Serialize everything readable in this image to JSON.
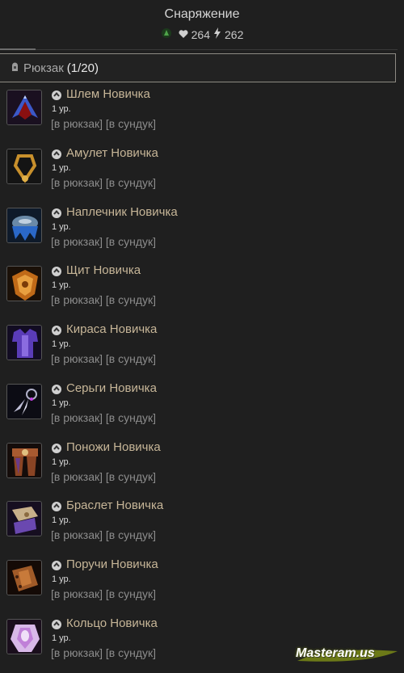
{
  "header": {
    "title": "Снаряжение",
    "health_value": "264",
    "energy_value": "262",
    "accent_color": "#c7b698"
  },
  "backpack": {
    "label": "Рюкзак",
    "count": "(1/20)"
  },
  "items": [
    {
      "name": "Шлем Новичка",
      "level": "1 ур.",
      "to_backpack": "[в рюкзак]",
      "to_chest": "[в сундук]",
      "icon": "helmet-icon"
    },
    {
      "name": "Амулет Новичка",
      "level": "1 ур.",
      "to_backpack": "[в рюкзак]",
      "to_chest": "[в сундук]",
      "icon": "amulet-icon"
    },
    {
      "name": "Наплечник Новичка",
      "level": "1 ур.",
      "to_backpack": "[в рюкзак]",
      "to_chest": "[в сундук]",
      "icon": "shoulder-icon"
    },
    {
      "name": "Щит Новичка",
      "level": "1 ур.",
      "to_backpack": "[в рюкзак]",
      "to_chest": "[в сундук]",
      "icon": "shield-icon"
    },
    {
      "name": "Кираса Новичка",
      "level": "1 ур.",
      "to_backpack": "[в рюкзак]",
      "to_chest": "[в сундук]",
      "icon": "cuirass-icon"
    },
    {
      "name": "Серьги Новичка",
      "level": "1 ур.",
      "to_backpack": "[в рюкзак]",
      "to_chest": "[в сундук]",
      "icon": "earrings-icon"
    },
    {
      "name": "Поножи Новичка",
      "level": "1 ур.",
      "to_backpack": "[в рюкзак]",
      "to_chest": "[в сундук]",
      "icon": "leggings-icon"
    },
    {
      "name": "Браслет Новичка",
      "level": "1 ур.",
      "to_backpack": "[в рюкзак]",
      "to_chest": "[в сундук]",
      "icon": "bracelet-icon"
    },
    {
      "name": "Поручи Новичка",
      "level": "1 ур.",
      "to_backpack": "[в рюкзак]",
      "to_chest": "[в сундук]",
      "icon": "bracers-icon"
    },
    {
      "name": "Кольцо Новичка",
      "level": "1 ур.",
      "to_backpack": "[в рюкзак]",
      "to_chest": "[в сундук]",
      "icon": "ring-icon"
    }
  ],
  "watermark": {
    "text": "Masteram.us"
  }
}
